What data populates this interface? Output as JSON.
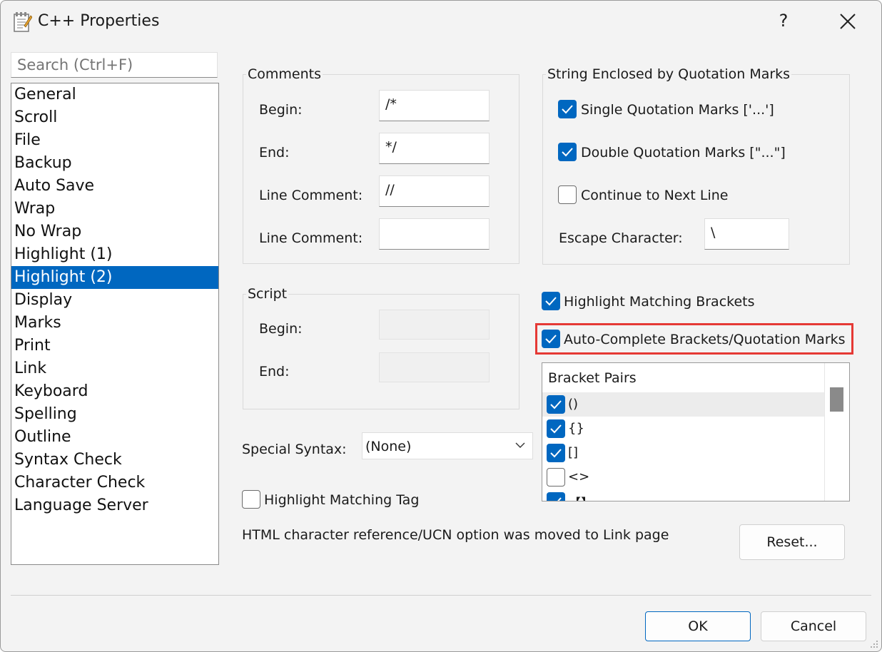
{
  "window": {
    "title": "C++ Properties",
    "help_label": "?",
    "close_icon": "close-icon"
  },
  "search": {
    "placeholder": "Search (Ctrl+F)"
  },
  "nav": {
    "items": [
      {
        "label": "General"
      },
      {
        "label": "Scroll"
      },
      {
        "label": "File"
      },
      {
        "label": "Backup"
      },
      {
        "label": "Auto Save"
      },
      {
        "label": "Wrap"
      },
      {
        "label": "No Wrap"
      },
      {
        "label": "Highlight (1)"
      },
      {
        "label": "Highlight (2)"
      },
      {
        "label": "Display"
      },
      {
        "label": "Marks"
      },
      {
        "label": "Print"
      },
      {
        "label": "Link"
      },
      {
        "label": "Keyboard"
      },
      {
        "label": "Spelling"
      },
      {
        "label": "Outline"
      },
      {
        "label": "Syntax Check"
      },
      {
        "label": "Character Check"
      },
      {
        "label": "Language Server"
      }
    ],
    "selected": "Highlight (2)"
  },
  "comments": {
    "title": "Comments",
    "begin_label": "Begin:",
    "begin_value": "/*",
    "end_label": "End:",
    "end_value": "*/",
    "line1_label": "Line Comment:",
    "line1_value": "//",
    "line2_label": "Line Comment:",
    "line2_value": ""
  },
  "script": {
    "title": "Script",
    "begin_label": "Begin:",
    "begin_value": "",
    "end_label": "End:",
    "end_value": ""
  },
  "strings": {
    "title": "String Enclosed by Quotation Marks",
    "single_label": "Single Quotation Marks ['...']",
    "single_checked": true,
    "double_label": "Double Quotation Marks [\"...\"]",
    "double_checked": true,
    "continue_label": "Continue to Next Line",
    "continue_checked": false,
    "escape_label": "Escape Character:",
    "escape_value": "\\"
  },
  "highlight_brackets": {
    "label": "Highlight Matching Brackets",
    "checked": true
  },
  "auto_complete": {
    "label": "Auto-Complete Brackets/Quotation Marks",
    "checked": true
  },
  "bracket_pairs": {
    "header": "Bracket Pairs",
    "rows": [
      {
        "text": "()",
        "checked": true
      },
      {
        "text": "{}",
        "checked": true
      },
      {
        "text": "[]",
        "checked": true
      },
      {
        "text": "<>",
        "checked": false
      },
      {
        "text": "【】",
        "checked": true
      }
    ]
  },
  "special_syntax": {
    "label": "Special Syntax:",
    "value": "(None)"
  },
  "highlight_tag": {
    "label": "Highlight Matching Tag",
    "checked": false
  },
  "info_text": "HTML character reference/UCN option was moved to Link page",
  "buttons": {
    "reset": "Reset...",
    "ok": "OK",
    "cancel": "Cancel"
  },
  "colors": {
    "accent": "#0067c0",
    "highlight_border": "#e53935"
  }
}
